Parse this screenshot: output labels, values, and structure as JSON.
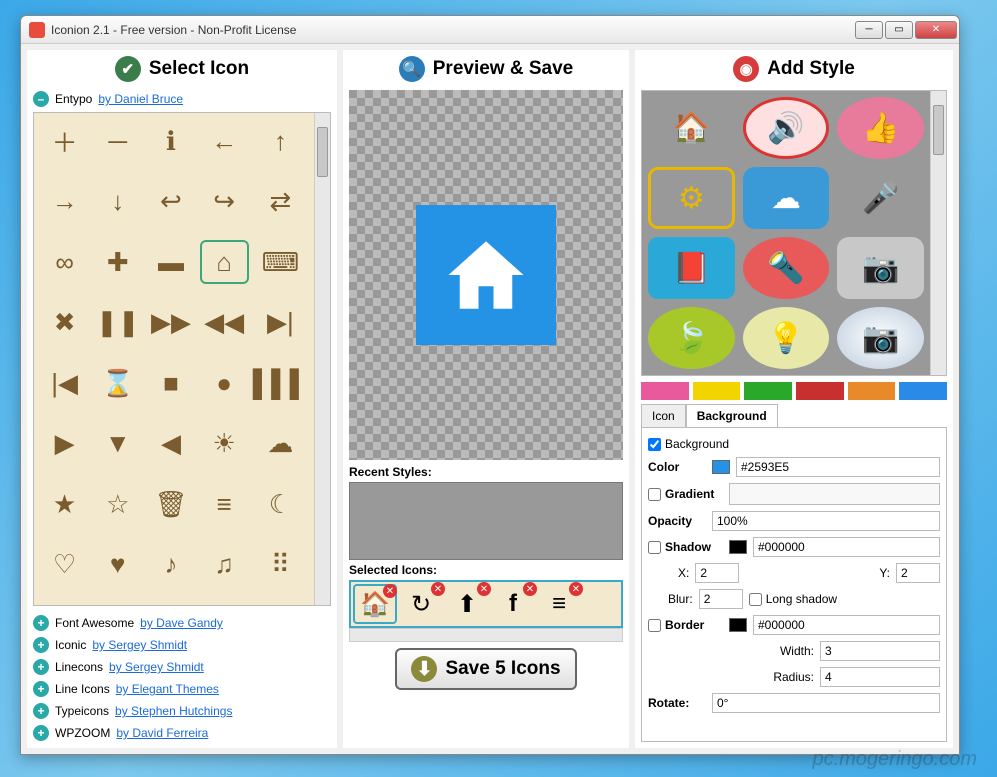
{
  "window": {
    "title": "Iconion 2.1 - Free version - Non-Profit License"
  },
  "watermark": "pc.mogeringo.com",
  "panels": {
    "left_title": "Select Icon",
    "mid_title": "Preview & Save",
    "right_title": "Add Style"
  },
  "icon_sources": {
    "open": {
      "name": "Entypo",
      "author": "by Daniel Bruce"
    },
    "collapsed": [
      {
        "name": "Font Awesome",
        "author": "by Dave Gandy"
      },
      {
        "name": "Iconic",
        "author": "by Sergey Shmidt"
      },
      {
        "name": "Linecons",
        "author": "by Sergey Shmidt"
      },
      {
        "name": "Line Icons",
        "author": "by Elegant Themes"
      },
      {
        "name": "Typeicons",
        "author": "by Stephen Hutchings"
      },
      {
        "name": "WPZOOM",
        "author": "by David Ferreira"
      }
    ]
  },
  "icon_grid": [
    "＋",
    "－",
    "ℹ",
    "←",
    "↑",
    "→",
    "↓",
    "↩",
    "↪",
    "⇄",
    "∞",
    "✚",
    "▬",
    "⌂",
    "⌨",
    "✖",
    "❚❚",
    "▶▶",
    "◀◀",
    "▶|",
    "|◀",
    "⌛",
    "■",
    "●",
    "▌▌▌",
    "▶",
    "▼",
    "◀",
    "☀",
    "☁",
    "★",
    "☆",
    "🗑",
    "≡",
    "☾",
    "♡",
    "♥",
    "♪",
    "♫",
    "⠿"
  ],
  "selected_icon_index": 13,
  "preview": {
    "recent_label": "Recent Styles:",
    "selected_label": "Selected Icons:",
    "selected_icons": [
      "home",
      "rotate",
      "upload",
      "facebook",
      "database"
    ]
  },
  "save_button": "Save 5 Icons",
  "style_presets_colors": [
    "#e85a9c",
    "#f2d500",
    "#2aa82a",
    "#c83030",
    "#e88a2a",
    "#2a8ae8"
  ],
  "tabs": {
    "icon": "Icon",
    "background": "Background",
    "active": "Background"
  },
  "background_props": {
    "enable_label": "Background",
    "enable_checked": true,
    "color_label": "Color",
    "color_value": "#2593E5",
    "gradient_label": "Gradient",
    "gradient_checked": false,
    "opacity_label": "Opacity",
    "opacity_value": "100%",
    "shadow_label": "Shadow",
    "shadow_checked": false,
    "shadow_color": "#000000",
    "shadow_x_label": "X:",
    "shadow_x": "2",
    "shadow_y_label": "Y:",
    "shadow_y": "2",
    "blur_label": "Blur:",
    "blur": "2",
    "longshadow_label": "Long shadow",
    "longshadow_checked": false,
    "border_label": "Border",
    "border_checked": false,
    "border_color": "#000000",
    "width_label": "Width:",
    "width": "3",
    "radius_label": "Radius:",
    "radius": "4",
    "rotate_label": "Rotate:",
    "rotate": "0°"
  }
}
